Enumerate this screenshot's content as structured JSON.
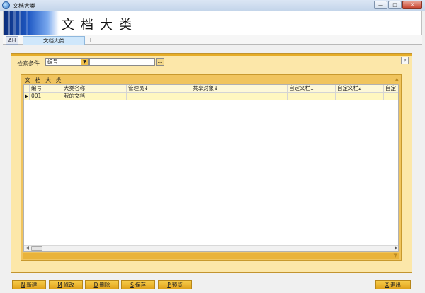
{
  "window": {
    "title": "文档大类",
    "buttons": [
      "—",
      "□",
      "✕"
    ]
  },
  "banner": {
    "title": "文档大类"
  },
  "tabs": {
    "items": [
      {
        "label": "AH"
      },
      {
        "label": "文档大类"
      },
      {
        "label": "+"
      }
    ]
  },
  "search": {
    "label": "检索条件",
    "field_value": "编号",
    "text_value": "",
    "browse_label": "..."
  },
  "panel": {
    "title": "文 档 大 类",
    "columns": [
      {
        "label": ""
      },
      {
        "label": "编号"
      },
      {
        "label": "大类名称"
      },
      {
        "label": "管理员↓"
      },
      {
        "label": "共享对象↓"
      },
      {
        "label": "自定义栏1"
      },
      {
        "label": "自定义栏2"
      },
      {
        "label": "自定"
      }
    ],
    "rows": [
      {
        "code": "001",
        "name": "我的文档",
        "admin": "",
        "share": "",
        "c1": "",
        "c2": "",
        "c3": ""
      }
    ]
  },
  "toolbar": {
    "new": {
      "key": "N",
      "label": "新建"
    },
    "edit": {
      "key": "M",
      "label": "修改"
    },
    "delete": {
      "key": "D",
      "label": "删除"
    },
    "save": {
      "key": "S",
      "label": "保存"
    },
    "preview": {
      "key": "P",
      "label": "预览"
    },
    "exit": {
      "key": "X",
      "label": "退出"
    }
  },
  "colors": {
    "accent": "#e5ac28",
    "frame": "#fce7a9",
    "button": "#f6cb4a",
    "selected_row": "#fff7c0"
  }
}
